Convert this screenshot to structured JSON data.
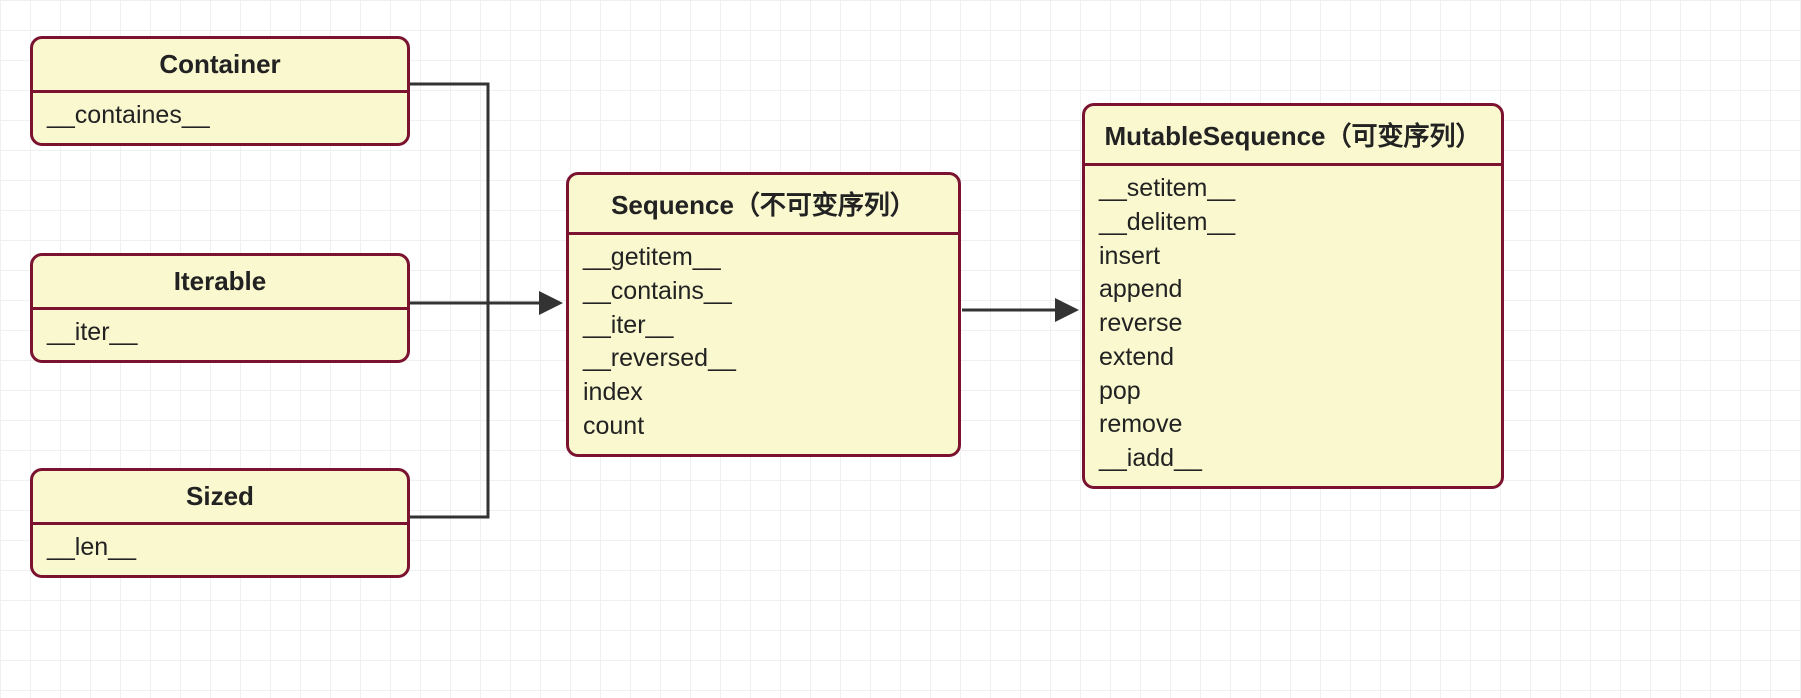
{
  "boxes": {
    "container": {
      "title": "Container",
      "methods": [
        "__containes__"
      ]
    },
    "iterable": {
      "title": "Iterable",
      "methods": [
        "__iter__"
      ]
    },
    "sized": {
      "title": "Sized",
      "methods": [
        "__len__"
      ]
    },
    "sequence": {
      "title": "Sequence（不可变序列）",
      "methods": [
        "__getitem__",
        "__contains__",
        "__iter__",
        "__reversed__",
        "index",
        "count"
      ]
    },
    "mutable": {
      "title": "MutableSequence（可变序列）",
      "methods": [
        "__setitem__",
        "__delitem__",
        "insert",
        "append",
        "reverse",
        "extend",
        "pop",
        "remove",
        "__iadd__"
      ]
    }
  }
}
